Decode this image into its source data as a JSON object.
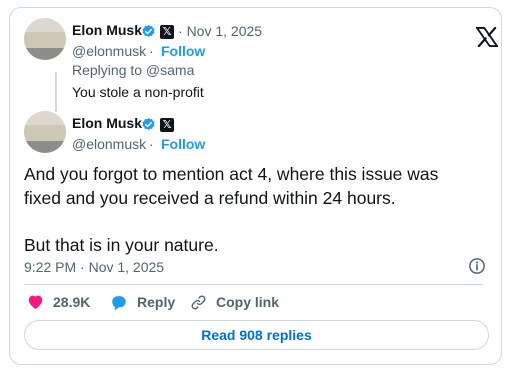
{
  "colors": {
    "accent": "#1d9bf0",
    "like": "#f91880",
    "text": "#0f1419",
    "muted": "#536471",
    "border": "#cfd9de"
  },
  "quoted_tweet": {
    "author_name": "Elon Musk",
    "handle": "@elonmusk",
    "date": "Nov 1, 2025",
    "separator": "·",
    "follow_label": "Follow",
    "replying_to": "Replying to @sama",
    "text": "You stole a non-profit"
  },
  "tweet": {
    "author_name": "Elon Musk",
    "handle": "@elonmusk",
    "separator": "·",
    "follow_label": "Follow",
    "text_line1": "And you forgot to mention act 4, where this issue was fixed and you received a refund within 24 hours.",
    "text_line2": "But that is in your nature.",
    "timestamp": "9:22 PM · Nov 1, 2025"
  },
  "actions": {
    "likes": "28.9K",
    "reply_label": "Reply",
    "copy_link_label": "Copy link"
  },
  "read_replies_label": "Read 908 replies",
  "icons": [
    "x-logo-icon",
    "verified-badge-icon",
    "affiliate-x-icon",
    "info-icon",
    "heart-icon",
    "reply-bubble-icon",
    "link-icon"
  ]
}
